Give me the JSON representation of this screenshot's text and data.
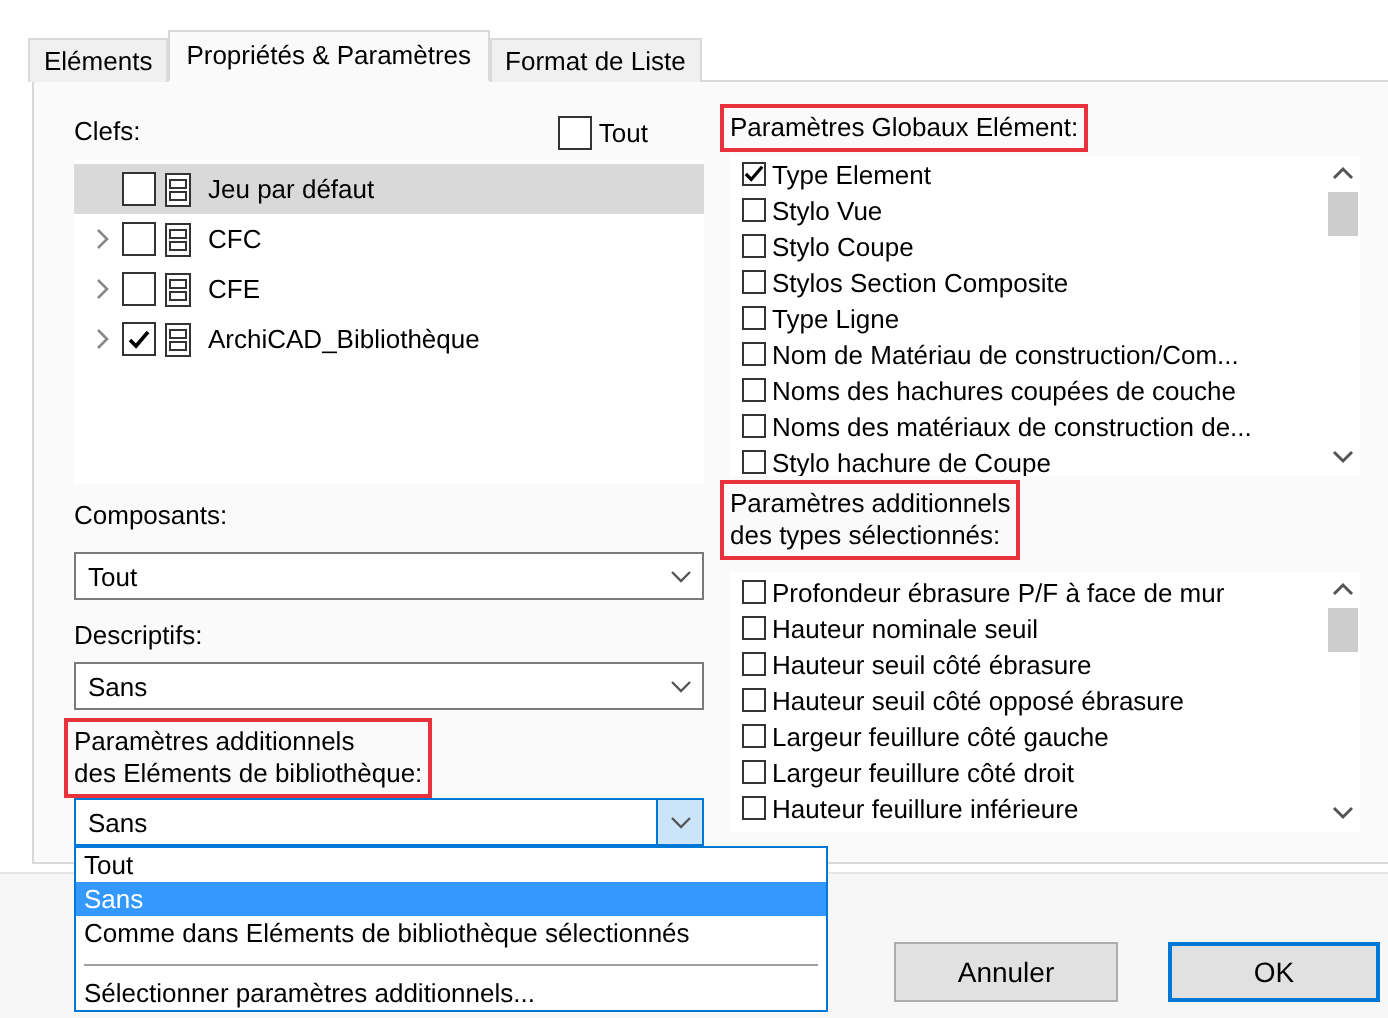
{
  "tabs": [
    {
      "label": "Eléments",
      "selected": false
    },
    {
      "label": "Propriétés & Paramètres",
      "selected": true
    },
    {
      "label": "Format de Liste",
      "selected": false
    }
  ],
  "keys": {
    "label": "Clefs:",
    "highlighted": false,
    "all_toggle": {
      "label": "Tout",
      "checked": false
    },
    "items": [
      {
        "label": "Jeu par défaut",
        "expandable": false,
        "checked": false,
        "selected": true
      },
      {
        "label": "CFC",
        "expandable": true,
        "checked": false,
        "selected": false
      },
      {
        "label": "CFE",
        "expandable": true,
        "checked": false,
        "selected": false
      },
      {
        "label": "ArchiCAD_Bibliothèque",
        "expandable": true,
        "checked": true,
        "selected": false
      }
    ]
  },
  "selects": [
    {
      "label": "Composants:",
      "highlighted": false,
      "value": "Tout",
      "focused": false,
      "open": false
    },
    {
      "label": "Descriptifs:",
      "highlighted": false,
      "value": "Sans",
      "focused": false,
      "open": false
    },
    {
      "label": "Paramètres additionnels\ndes Eléments de bibliothèque:",
      "highlighted": true,
      "value": "Sans",
      "focused": true,
      "open": true,
      "options": [
        {
          "label": "Tout",
          "selected": false,
          "separator_before": false
        },
        {
          "label": "Sans",
          "selected": true,
          "separator_before": false
        },
        {
          "label": "Comme dans Eléments de bibliothèque sélectionnés",
          "selected": false,
          "separator_before": false
        },
        {
          "label": "Sélectionner paramètres additionnels...",
          "selected": false,
          "separator_before": true
        }
      ]
    }
  ],
  "lists": [
    {
      "label": "Paramètres Globaux Elément:",
      "highlighted": true,
      "items": [
        {
          "label": "Type Element",
          "checked": true
        },
        {
          "label": "Stylo Vue",
          "checked": false
        },
        {
          "label": "Stylo Coupe",
          "checked": false
        },
        {
          "label": "Stylos Section Composite",
          "checked": false
        },
        {
          "label": "Type Ligne",
          "checked": false
        },
        {
          "label": "Nom de Matériau de construction/Com...",
          "checked": false
        },
        {
          "label": "Noms des hachures coupées de couche",
          "checked": false
        },
        {
          "label": "Noms des matériaux de construction de...",
          "checked": false
        },
        {
          "label": "Stylo hachure de Coupe",
          "checked": false
        }
      ]
    },
    {
      "label": "Paramètres additionnels\ndes types sélectionnés:",
      "highlighted": true,
      "items": [
        {
          "label": "Profondeur ébrasure P/F à face de mur",
          "checked": false
        },
        {
          "label": "Hauteur nominale seuil",
          "checked": false
        },
        {
          "label": "Hauteur seuil côté ébrasure",
          "checked": false
        },
        {
          "label": "Hauteur seuil côté opposé ébrasure",
          "checked": false
        },
        {
          "label": "Largeur feuillure côté gauche",
          "checked": false
        },
        {
          "label": "Largeur feuillure côté droit",
          "checked": false
        },
        {
          "label": "Hauteur feuillure inférieure",
          "checked": false
        }
      ]
    }
  ],
  "buttons": [
    {
      "label": "Annuler",
      "default": false
    },
    {
      "label": "OK",
      "default": true
    }
  ]
}
